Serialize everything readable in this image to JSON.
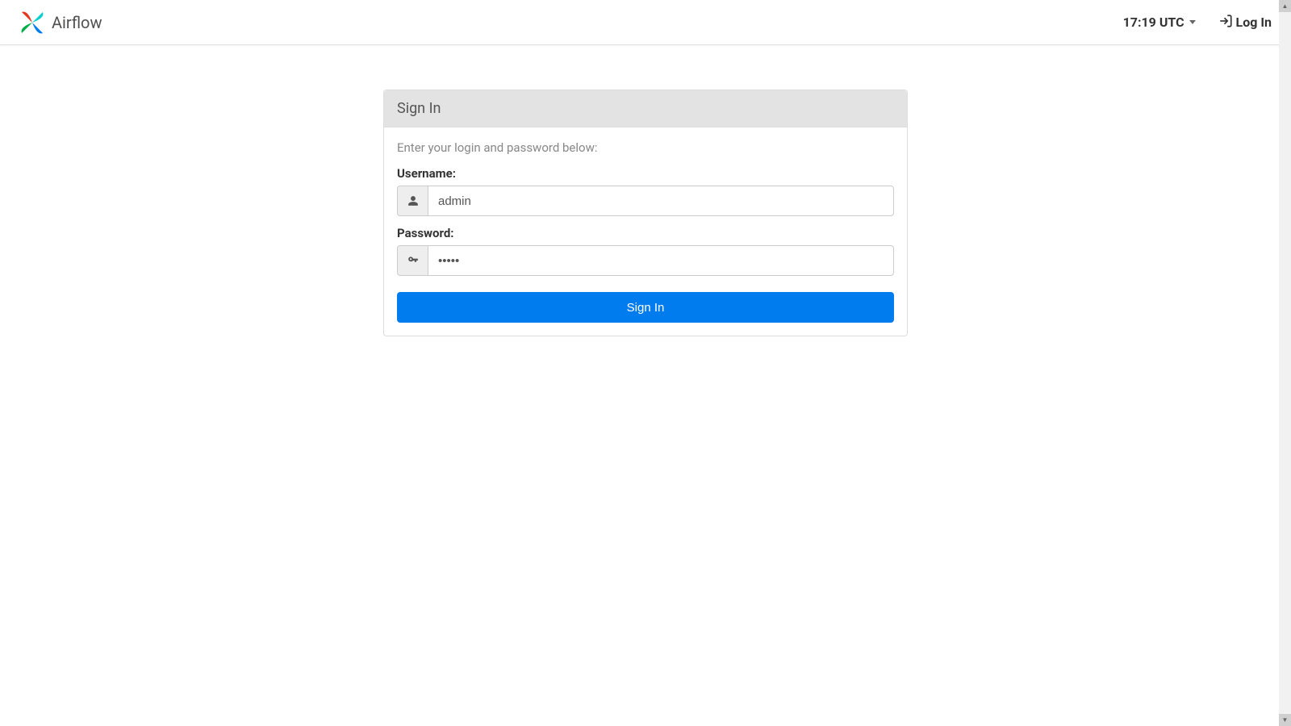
{
  "navbar": {
    "brand_text": "Airflow",
    "time": "17:19 UTC",
    "login_link": "Log In"
  },
  "panel": {
    "title": "Sign In",
    "instruction": "Enter your login and password below:",
    "username_label": "Username:",
    "username_value": "admin",
    "password_label": "Password:",
    "password_value": "•••••",
    "submit_label": "Sign In"
  },
  "colors": {
    "primary": "#017cee",
    "pinwheel_red": "#e43921",
    "pinwheel_green": "#00ad46",
    "pinwheel_cyan": "#04d0d0",
    "pinwheel_blue": "#017cee"
  }
}
